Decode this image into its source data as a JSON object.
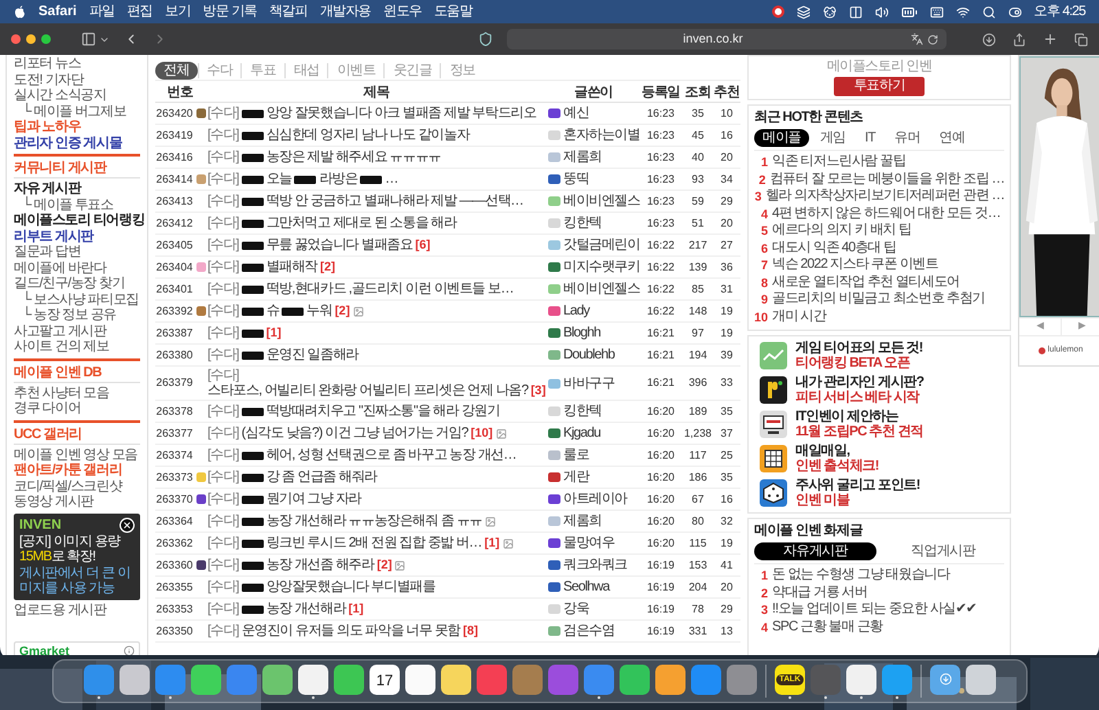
{
  "menu_bar": {
    "app": "Safari",
    "menus": [
      "파일",
      "편집",
      "보기",
      "방문 기록",
      "책갈피",
      "개발자용",
      "윈도우",
      "도움말"
    ],
    "clock": "오후 4:25"
  },
  "browser": {
    "url": "inven.co.kr"
  },
  "sidebar": {
    "sections": [
      {
        "items": [
          {
            "label": "리포터 뉴스",
            "kind": "plain"
          },
          {
            "label": "도전! 기자단",
            "kind": "plain"
          },
          {
            "label": "실시간 소식공지",
            "kind": "plain",
            "children": [
              {
                "label": "└ 메이플 버그제보",
                "kind": "plain"
              }
            ]
          },
          {
            "label": "팁과 노하우",
            "kind": "red"
          },
          {
            "label": "관리자 인증 게시물",
            "kind": "blue"
          }
        ]
      },
      {
        "title": "커뮤니티 게시판",
        "items": [
          {
            "label": "자유 게시판",
            "kind": "bold",
            "children": [
              {
                "label": "└ 메이플 투표소",
                "kind": "plain"
              }
            ]
          },
          {
            "label": "메이플스토리 티어랭킹",
            "kind": "bold"
          },
          {
            "label": "리부트 게시판",
            "kind": "blue"
          },
          {
            "label": "질문과 답변",
            "kind": "plain"
          },
          {
            "label": "메이플에 바란다",
            "kind": "plain"
          },
          {
            "label": "길드/친구/농장 찾기",
            "kind": "plain",
            "children": [
              {
                "label": "└ 보스사냥 파티모집",
                "kind": "plain"
              },
              {
                "label": "└ 농장 정보 공유",
                "kind": "plain"
              }
            ]
          },
          {
            "label": "사고팔고 게시판",
            "kind": "plain"
          },
          {
            "label": "사이트 건의 제보",
            "kind": "plain"
          }
        ]
      },
      {
        "title": "메이플 인벤 DB",
        "items": [
          {
            "label": "추천 사냥터 모음",
            "kind": "plain"
          },
          {
            "label": "경쿠 다이어",
            "kind": "plain"
          }
        ]
      },
      {
        "title": "UCC 갤러리",
        "items": [
          {
            "label": "메이플 인벤 영상 모음",
            "kind": "plain"
          },
          {
            "label": "팬아트/카툰 갤러리",
            "kind": "red"
          },
          {
            "label": "코디/픽셀/스크린샷",
            "kind": "plain"
          },
          {
            "label": "동영상 게시판",
            "kind": "plain"
          },
          {
            "label": "업로드용 게시판",
            "kind": "plain"
          }
        ]
      }
    ],
    "ad": "Gmarket"
  },
  "notice_popup": {
    "logo": "INVEN",
    "title_before": "[공지] 이미지 용량 ",
    "title_highlight": "15MB",
    "title_after": "로 확장!",
    "body": "게시판에서 더 큰 이미지를 사용 가능"
  },
  "main": {
    "tabs": [
      {
        "label": "전체",
        "selected": true
      },
      {
        "label": "수다",
        "selected": false
      },
      {
        "label": "투표",
        "selected": false
      },
      {
        "label": "태섭",
        "selected": false
      },
      {
        "label": "이벤트",
        "selected": false
      },
      {
        "label": "웃긴글",
        "selected": false
      },
      {
        "label": "정보",
        "selected": false
      }
    ],
    "columns": [
      "번호",
      "제목",
      "글쓴이",
      "등록일",
      "조회",
      "추천"
    ],
    "rows": [
      {
        "number": "263420",
        "emblem": {
          "color": "#8a6a3a"
        },
        "category": "[수다]",
        "segments": [
          {
            "kind": "redacted"
          },
          {
            "kind": "text",
            "text": "앙앙 잘못했습니다 아크 별패좀 제발 부탁드리오"
          }
        ],
        "image": false,
        "author": "예신",
        "author_icon": {
          "color": "#6b3fd4"
        },
        "date": "16:23",
        "views": "35",
        "likes": "10"
      },
      {
        "number": "263419",
        "category": "[수다]",
        "segments": [
          {
            "kind": "redacted"
          },
          {
            "kind": "text",
            "text": "심심한데 엉자리 남나 나도 같이놀자"
          }
        ],
        "image": false,
        "author": "혼자하는이별",
        "author_icon": {
          "color": "#d8d8d8"
        },
        "date": "16:23",
        "views": "45",
        "likes": "16"
      },
      {
        "number": "263416",
        "category": "[수다]",
        "segments": [
          {
            "kind": "redacted"
          },
          {
            "kind": "text",
            "text": "농장은 제발 해주세요 ㅠㅠㅠㅠ"
          }
        ],
        "image": false,
        "author": "제롬희",
        "author_icon": {
          "color": "#b9c6d8"
        },
        "date": "16:23",
        "views": "40",
        "likes": "20"
      },
      {
        "number": "263414",
        "emblem": {
          "color": "#c9a070"
        },
        "category": "[수다]",
        "segments": [
          {
            "kind": "redacted"
          },
          {
            "kind": "text",
            "text": "오늘"
          },
          {
            "kind": "redacted"
          },
          {
            "kind": "text",
            "text": "라방은"
          },
          {
            "kind": "redacted"
          },
          {
            "kind": "text",
            "text": "…"
          }
        ],
        "image": false,
        "author": "뚱띡",
        "author_icon": {
          "color": "#2f5fb8"
        },
        "date": "16:23",
        "views": "93",
        "likes": "34"
      },
      {
        "number": "263413",
        "category": "[수다]",
        "segments": [
          {
            "kind": "redacted"
          },
          {
            "kind": "text",
            "text": "떡방 안 궁금하고 별패나해라 제발 ——선택…"
          }
        ],
        "image": false,
        "author": "베이비엔젤스",
        "author_icon": {
          "color": "#8fcf8a"
        },
        "date": "16:23",
        "views": "59",
        "likes": "29"
      },
      {
        "number": "263412",
        "category": "[수다]",
        "segments": [
          {
            "kind": "redacted"
          },
          {
            "kind": "text",
            "text": "그만처먹고 제대로 된 소통을 해라"
          }
        ],
        "image": false,
        "author": "킹한텍",
        "author_icon": {
          "color": "#d8d8d8"
        },
        "date": "16:23",
        "views": "51",
        "likes": "20"
      },
      {
        "number": "263405",
        "category": "[수다]",
        "segments": [
          {
            "kind": "redacted"
          },
          {
            "kind": "text",
            "text": "무릎 꿇었습니다 별패좀요"
          },
          {
            "kind": "comments",
            "text": "[6]"
          }
        ],
        "image": false,
        "author": "갓털금메린이",
        "author_icon": {
          "color": "#9cc8e0"
        },
        "date": "16:22",
        "views": "217",
        "likes": "27"
      },
      {
        "number": "263404",
        "emblem": {
          "color": "#f2a8c8"
        },
        "category": "[수다]",
        "segments": [
          {
            "kind": "redacted"
          },
          {
            "kind": "text",
            "text": "별패해작"
          },
          {
            "kind": "comments",
            "text": "[2]"
          }
        ],
        "image": false,
        "author": "미지수랫쿠키",
        "author_icon": {
          "color": "#2f7a4a"
        },
        "date": "16:22",
        "views": "139",
        "likes": "36"
      },
      {
        "number": "263401",
        "category": "[수다]",
        "segments": [
          {
            "kind": "redacted"
          },
          {
            "kind": "text",
            "text": "떡방,현대카드 ,골드리치 이런 이벤트들 보…"
          }
        ],
        "image": false,
        "author": "베이비엔젤스",
        "author_icon": {
          "color": "#8fcf8a"
        },
        "date": "16:22",
        "views": "85",
        "likes": "31"
      },
      {
        "number": "263392",
        "emblem": {
          "color": "#b07a40"
        },
        "category": "[수다]",
        "segments": [
          {
            "kind": "redacted"
          },
          {
            "kind": "text",
            "text": "슈"
          },
          {
            "kind": "redacted"
          },
          {
            "kind": "text",
            "text": "누워"
          },
          {
            "kind": "comments",
            "text": "[2]"
          }
        ],
        "image": true,
        "author": "Lady",
        "author_icon": {
          "color": "#e8508a"
        },
        "date": "16:22",
        "views": "148",
        "likes": "19"
      },
      {
        "number": "263387",
        "category": "[수다]",
        "segments": [
          {
            "kind": "redacted"
          },
          {
            "kind": "comments",
            "text": "[1]"
          }
        ],
        "image": false,
        "author": "Bloghh",
        "author_icon": {
          "color": "#2f7a4a"
        },
        "date": "16:21",
        "views": "97",
        "likes": "19"
      },
      {
        "number": "263380",
        "category": "[수다]",
        "segments": [
          {
            "kind": "redacted"
          },
          {
            "kind": "text",
            "text": "운영진 일좀해라"
          }
        ],
        "image": false,
        "author": "Doublehb",
        "author_icon": {
          "color": "#7fb88a"
        },
        "date": "16:21",
        "views": "194",
        "likes": "39"
      },
      {
        "number": "263379",
        "category": "[수다]",
        "segments": [
          {
            "kind": "text",
            "text": "스타포스, 어빌리티 완화랑 어빌리티 프리셋은 언제 나옴?"
          },
          {
            "kind": "comments",
            "text": "[3]"
          }
        ],
        "image": false,
        "author": "바바구구",
        "author_icon": {
          "color": "#8fc0e0"
        },
        "date": "16:21",
        "views": "396",
        "likes": "33"
      },
      {
        "number": "263378",
        "category": "[수다]",
        "segments": [
          {
            "kind": "redacted"
          },
          {
            "kind": "text",
            "text": "떡방때려치우고 \"진짜소통\"을 해라 강원기"
          }
        ],
        "image": false,
        "author": "킹한텍",
        "author_icon": {
          "color": "#d8d8d8"
        },
        "date": "16:20",
        "views": "189",
        "likes": "35"
      },
      {
        "number": "263377",
        "category": "[수다]",
        "segments": [
          {
            "kind": "text",
            "text": "(심각도 낮음?) 이건 그냥 넘어가는 거임?"
          },
          {
            "kind": "comments",
            "text": "[10]"
          }
        ],
        "image": true,
        "author": "Kjgadu",
        "author_icon": {
          "color": "#2f7a4a"
        },
        "date": "16:20",
        "views": "1,238",
        "likes": "37"
      },
      {
        "number": "263374",
        "category": "[수다]",
        "segments": [
          {
            "kind": "redacted"
          },
          {
            "kind": "text",
            "text": "헤어, 성형 선택권으로 좀 바꾸고 농장 개선…"
          }
        ],
        "image": false,
        "author": "룰로",
        "author_icon": {
          "color": "#b9c0cc"
        },
        "date": "16:20",
        "views": "117",
        "likes": "25"
      },
      {
        "number": "263373",
        "emblem": {
          "color": "#f0c840"
        },
        "category": "[수다]",
        "segments": [
          {
            "kind": "redacted"
          },
          {
            "kind": "text",
            "text": "강 좀 언급좀 해줘라"
          }
        ],
        "image": false,
        "author": "게란",
        "author_icon": {
          "color": "#c83030"
        },
        "date": "16:20",
        "views": "186",
        "likes": "35"
      },
      {
        "number": "263370",
        "emblem": {
          "color": "#6a3fc8"
        },
        "category": "[수다]",
        "segments": [
          {
            "kind": "redacted"
          },
          {
            "kind": "text",
            "text": "뭔기여 그냥 자라"
          }
        ],
        "image": false,
        "author": "아트레이아",
        "author_icon": {
          "color": "#6b3fd4"
        },
        "date": "16:20",
        "views": "67",
        "likes": "16"
      },
      {
        "number": "263364",
        "category": "[수다]",
        "segments": [
          {
            "kind": "redacted"
          },
          {
            "kind": "text",
            "text": "농장 개선해라 ㅠㅠ농장은해줘 좀 ㅠㅠ"
          }
        ],
        "image": true,
        "author": "제롬희",
        "author_icon": {
          "color": "#b9c6d8"
        },
        "date": "16:20",
        "views": "80",
        "likes": "32"
      },
      {
        "number": "263362",
        "category": "[수다]",
        "segments": [
          {
            "kind": "redacted"
          },
          {
            "kind": "text",
            "text": "링크빈 루시드 2배 전원 집합 중밟 버…"
          },
          {
            "kind": "comments",
            "text": "[1]"
          }
        ],
        "image": true,
        "author": "물망여우",
        "author_icon": {
          "color": "#6b3fd4"
        },
        "date": "16:20",
        "views": "115",
        "likes": "19"
      },
      {
        "number": "263360",
        "emblem": {
          "color": "#4a3a6a"
        },
        "category": "[수다]",
        "segments": [
          {
            "kind": "redacted"
          },
          {
            "kind": "text",
            "text": "농장 개선좀 해주라"
          },
          {
            "kind": "comments",
            "text": "[2]"
          }
        ],
        "image": true,
        "author": "쿼크와쿼크",
        "author_icon": {
          "color": "#2f5fb8"
        },
        "date": "16:19",
        "views": "153",
        "likes": "41"
      },
      {
        "number": "263355",
        "category": "[수다]",
        "segments": [
          {
            "kind": "redacted"
          },
          {
            "kind": "text",
            "text": "앙앙잘못했습니다 부디별패를"
          }
        ],
        "image": false,
        "author": "Seolhwa",
        "author_icon": {
          "color": "#2f5fb8"
        },
        "date": "16:19",
        "views": "204",
        "likes": "20"
      },
      {
        "number": "263353",
        "category": "[수다]",
        "segments": [
          {
            "kind": "redacted"
          },
          {
            "kind": "text",
            "text": "농장 개선해라"
          },
          {
            "kind": "comments",
            "text": "[1]"
          }
        ],
        "image": false,
        "author": "강욱",
        "author_icon": {
          "color": "#d8d8d8"
        },
        "date": "16:19",
        "views": "78",
        "likes": "29"
      },
      {
        "number": "263350",
        "category": "[수다]",
        "segments": [
          {
            "kind": "text",
            "text": "운영진이 유저들 의도 파악을 너무 못함"
          },
          {
            "kind": "comments",
            "text": "[8]"
          }
        ],
        "image": false,
        "author": "검은수염",
        "author_icon": {
          "color": "#7fb88a"
        },
        "date": "16:19",
        "views": "331",
        "likes": "13"
      }
    ]
  },
  "right": {
    "vote": {
      "caption": "메이플스토리 인벤",
      "button": "투표하기"
    },
    "hot": {
      "title": "최근 HOT한 콘텐츠",
      "tabs": [
        {
          "label": "메이플",
          "selected": true
        },
        {
          "label": "게임",
          "selected": false
        },
        {
          "label": "IT",
          "selected": false
        },
        {
          "label": "유머",
          "selected": false
        },
        {
          "label": "연예",
          "selected": false
        }
      ],
      "items": [
        {
          "rank": "1",
          "text": "익존 티저느린사람 꿀팁"
        },
        {
          "rank": "2",
          "text": "컴퓨터 잘 모르는 메붕이들을 위한 조립 …"
        },
        {
          "rank": "3",
          "text": "헬라 의자착상자리보기티저레퍼런 관련 …"
        },
        {
          "rank": "4",
          "text": "4편 변하지 않은 하드웨어 대한 모든 것…"
        },
        {
          "rank": "5",
          "text": "에르다의 의지 키 배치 팁"
        },
        {
          "rank": "6",
          "text": "대도시 익존 40층대 팁"
        },
        {
          "rank": "7",
          "text": "넥슨 2022 지스타 쿠폰 이벤트"
        },
        {
          "rank": "8",
          "text": "새로운 열티작업 추천 열티세도어"
        },
        {
          "rank": "9",
          "text": "골드리치의 비밀금고 최소번호 추첨기"
        },
        {
          "rank": "10",
          "text": "개미 시간"
        }
      ]
    },
    "promos": [
      {
        "kind": "chart",
        "line1": "게임 티어표의 모든 것!",
        "line2": "티어랭킹 BETA 오픈"
      },
      {
        "kind": "logo",
        "line1": "내가 관리자인 게시판?",
        "line2": "피티 서비스 베타 시작"
      },
      {
        "kind": "monitor",
        "line1": "IT인벤이 제안하는",
        "line2": "11월 조립PC 추천 견적"
      },
      {
        "kind": "calendar",
        "line1": "매일매일,",
        "line2": "인벤 출석체크!"
      },
      {
        "kind": "dice",
        "line1": "주사위 굴리고 포인트!",
        "line2": "인벤 미블"
      }
    ],
    "popular": {
      "title": "메이플 인벤 화제글",
      "tabs": [
        {
          "label": "자유게시판",
          "selected": true
        },
        {
          "label": "직업게시판",
          "selected": false
        }
      ],
      "items": [
        {
          "rank": "1",
          "text": "돈 없는 수형생 그냥 태웠습니다"
        },
        {
          "rank": "2",
          "text": "약대급 거룡 서버"
        },
        {
          "rank": "3",
          "text": "‼오늘 업데이트 되는 중요한 사실✔✔"
        },
        {
          "rank": "4",
          "text": "SPC 근황 불매 근황"
        }
      ]
    }
  },
  "ad": {
    "kind": "picture",
    "prev": "◀",
    "next": "▶",
    "brand": "lululemon"
  },
  "dock": [
    {
      "kind": "app",
      "color": "#2f8fea",
      "running": true
    },
    {
      "kind": "app",
      "color": "#c9c9cf",
      "running": false
    },
    {
      "kind": "app",
      "color": "#2d8cf0",
      "running": true
    },
    {
      "kind": "app",
      "color": "#3fd05a",
      "running": false
    },
    {
      "kind": "app",
      "color": "#3a86f0",
      "running": false
    },
    {
      "kind": "app",
      "color": "#6bc46d",
      "running": false
    },
    {
      "kind": "app",
      "color": "#f2f2f2",
      "running": true
    },
    {
      "kind": "app",
      "color": "#3dc653",
      "running": false
    },
    {
      "kind": "calendar",
      "color": "#ffffff",
      "label": "17",
      "running": false
    },
    {
      "kind": "app",
      "color": "#fafafa",
      "running": false
    },
    {
      "kind": "app",
      "color": "#f6d55c",
      "running": false
    },
    {
      "kind": "app",
      "color": "#f43f53",
      "running": false
    },
    {
      "kind": "app",
      "color": "#a57d4e",
      "running": false
    },
    {
      "kind": "app",
      "color": "#9b4ddc",
      "running": false
    },
    {
      "kind": "app",
      "color": "#3a8bf0",
      "running": true
    },
    {
      "kind": "app",
      "color": "#32c35a",
      "running": false
    },
    {
      "kind": "app",
      "color": "#f5a030",
      "running": false
    },
    {
      "kind": "app",
      "color": "#1f8cf5",
      "running": false
    },
    {
      "kind": "app",
      "color": "#8e8e93",
      "running": false
    },
    {
      "kind": "separator"
    },
    {
      "kind": "labeled",
      "color": "#f7e111",
      "label": "TALK",
      "running": true
    },
    {
      "kind": "app",
      "color": "#555558",
      "running": true
    },
    {
      "kind": "app",
      "color": "#f0f0f0",
      "running": true
    },
    {
      "kind": "app",
      "color": "#1da1f2",
      "running": true
    },
    {
      "kind": "separator"
    },
    {
      "kind": "folder",
      "color": "#5aa8e8",
      "running": false
    },
    {
      "kind": "trash",
      "color": "#cfd3d8",
      "running": false
    }
  ]
}
